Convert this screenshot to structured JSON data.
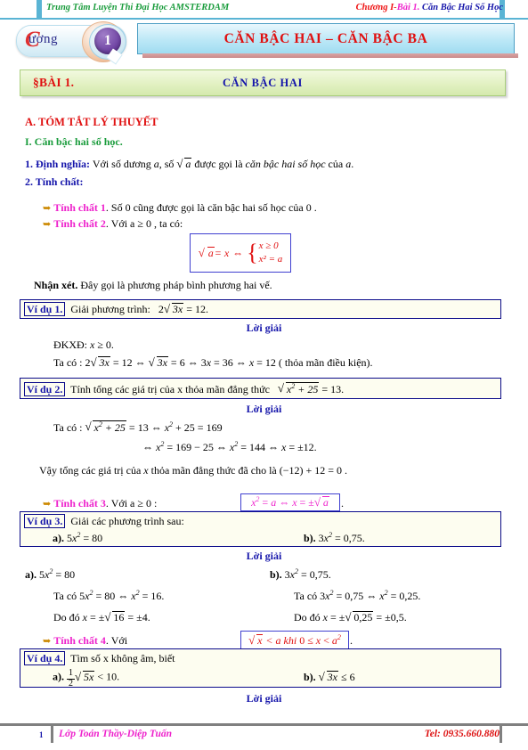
{
  "header": {
    "left": "Trung Tâm Luyện Thi Đại Học AMSTERDAM",
    "right_chapter": "Chương I-",
    "right_lesson": "Bài 1.",
    "right_topic": " Căn Bậc Hai Số Học"
  },
  "chapter_badge": {
    "word": "ương",
    "big_letter": "C",
    "number": "1"
  },
  "banner": {
    "title": "CĂN BẬC HAI – CĂN BẬC BA"
  },
  "lesson_bar": {
    "left": "§BÀI 1.",
    "title": "CĂN BẬC HAI"
  },
  "theory": {
    "section_a": "A. TÓM TẮT LÝ THUYẾT",
    "section_i": "I. Căn bậc hai số học.",
    "def_label": "1. Định nghĩa:",
    "def_text_1": "Với số dương",
    "def_a": "a",
    "def_text_2": ", số",
    "def_sqrt": "a",
    "def_text_3": "được gọi là",
    "def_italic": "căn bậc hai số học",
    "def_text_4": "của",
    "def_a2": "a",
    "def_dot": ".",
    "prop_label": "2. Tính chất:",
    "tc1_label": "Tính chất 1",
    "tc1_text": ". Số 0 cũng được gọi là căn bậc hai số học của 0 .",
    "tc2_label": "Tính chất 2",
    "tc2_text": ". Với a ≥ 0 , ta có:",
    "formula1": {
      "lhs": "a = x",
      "arrow": "⇔",
      "row1": "x  ≥ 0",
      "row2": "x² = a"
    },
    "nhanxet_label": "Nhận xét.",
    "nhanxet_text": "Đây gọi là phương pháp bình phương hai vế.",
    "tc3_label": "Tính chất 3",
    "tc3_text": ". Với a ≥ 0 :",
    "formula3": "x² = a ⇔ x  =  ±√a",
    "formula3_dot": ".",
    "tc4_label": "Tính chất 4",
    "tc4_text": ". Với",
    "formula4": "x < a khi 0 ≤ x  <  a²",
    "formula4_dot": "."
  },
  "examples": [
    {
      "label": "Ví dụ 1.",
      "prompt": "Giải phương trình:",
      "prompt_math": "2√3x = 12.",
      "solution_header": "Lời giải",
      "lines": [
        "ĐKXĐ:  x ≥ 0.",
        "Ta có :  2√3x = 12 ⇔ √3x = 6 ⇔ 3x = 36 ⇔ x = 12  ( thỏa mãn điều kiện)."
      ]
    },
    {
      "label": "Ví dụ 2.",
      "prompt": "Tính tổng các giá trị của  x  thỏa mãn đẳng thức",
      "prompt_math": "√x²+25 = 13.",
      "solution_header": "Lời giải",
      "lines": [
        "Ta có :  √x²+25 = 13  ⇔ x² + 25 = 169",
        "⇔ x² = 169 − 25 ⇔ x² = 144 ⇔ x = ±12.",
        "Vậy tổng các giá trị của  x  thỏa mãn đẳng thức  đã cho là (−12) + 12 = 0 ."
      ]
    },
    {
      "label": "Ví dụ 3.",
      "prompt": "Giải các phương trình sau:",
      "part_a": "a). 5x² = 80",
      "part_b": "b). 3x² = 0,75.",
      "solution_header": "Lời giải",
      "col_a": [
        "a). 5x² = 80",
        "Ta có  5x² = 80 ⇔ x² = 16.",
        "Do đó  x = ±√16 = ±4."
      ],
      "col_b": [
        "b). 3x² = 0,75.",
        "Ta có  3x² = 0,75 ⇔ x² = 0,25.",
        "Do đó  x = ±√0,25 = ±0,5."
      ]
    },
    {
      "label": "Ví dụ 4.",
      "prompt": "Tìm số  x không âm, biết",
      "part_a": "a). ½√5x < 10.",
      "part_b": "b). √3x ≤ 6",
      "solution_header": "Lời giải"
    }
  ],
  "footer": {
    "page": "1",
    "name": "Lớp Toán Thầy-Diệp Tuấn",
    "tel": "Tel: 0935.660.880"
  }
}
